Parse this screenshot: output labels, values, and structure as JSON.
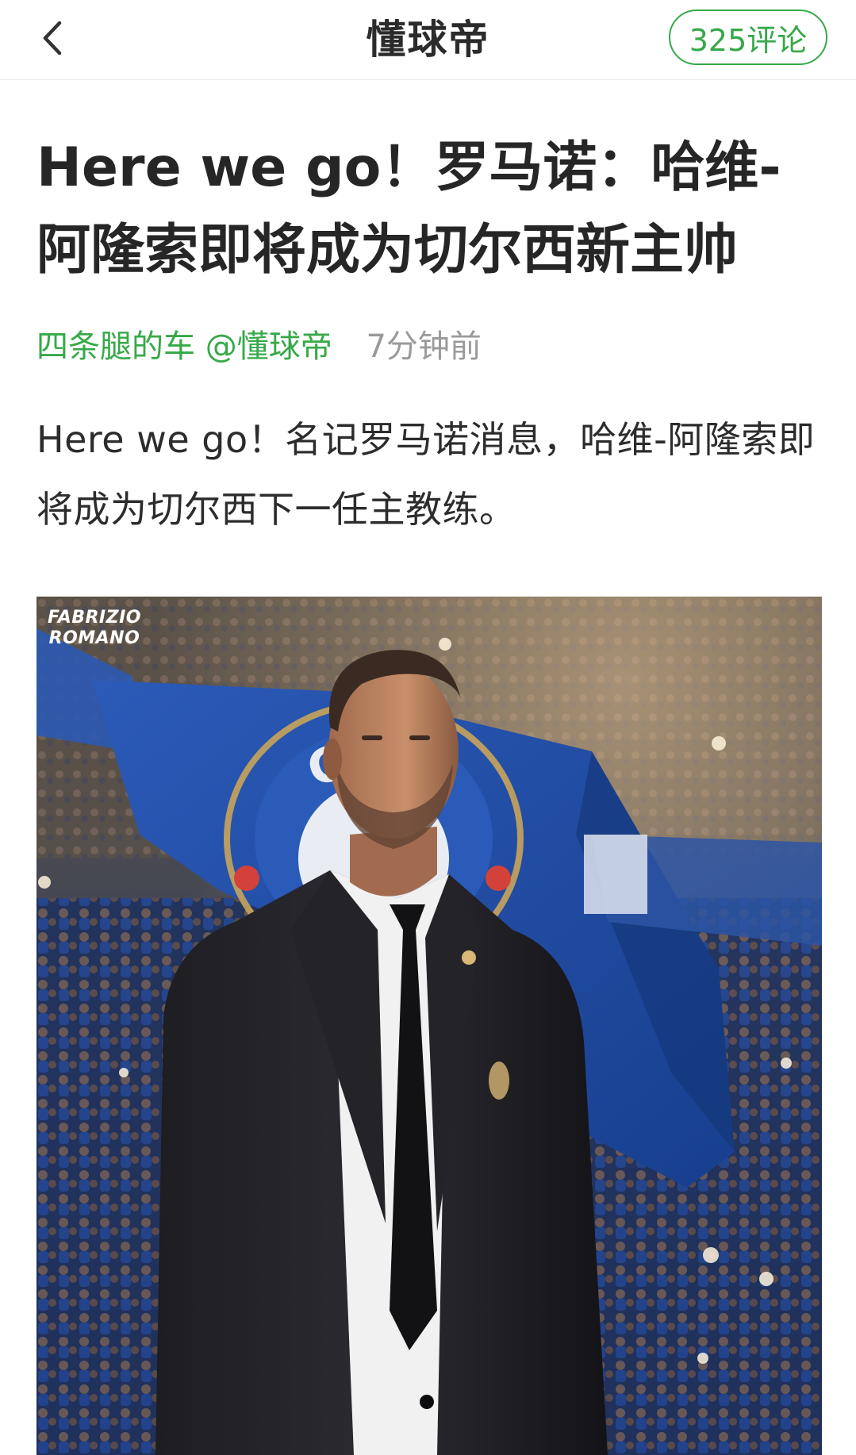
{
  "nav": {
    "back_icon": "chevron-left-icon",
    "title": "懂球帝",
    "comments_label": "325评论"
  },
  "article": {
    "headline": "Here we go！罗马诺：哈维-阿隆索即将成为切尔西新主帅",
    "author": "四条腿的车 @懂球帝",
    "publish_time": "7分钟前",
    "body": "Here we go！名记罗马诺消息，哈维-阿隆索即将成为切尔西下一任主教练。",
    "image": {
      "watermark_line1": "FABRIZIO",
      "watermark_line2": "ROMANO"
    }
  },
  "colors": {
    "accent_green": "#36a948",
    "text_dark": "#262626",
    "text_gray": "#9a9a9a",
    "flag_blue": "#1d47a3"
  }
}
